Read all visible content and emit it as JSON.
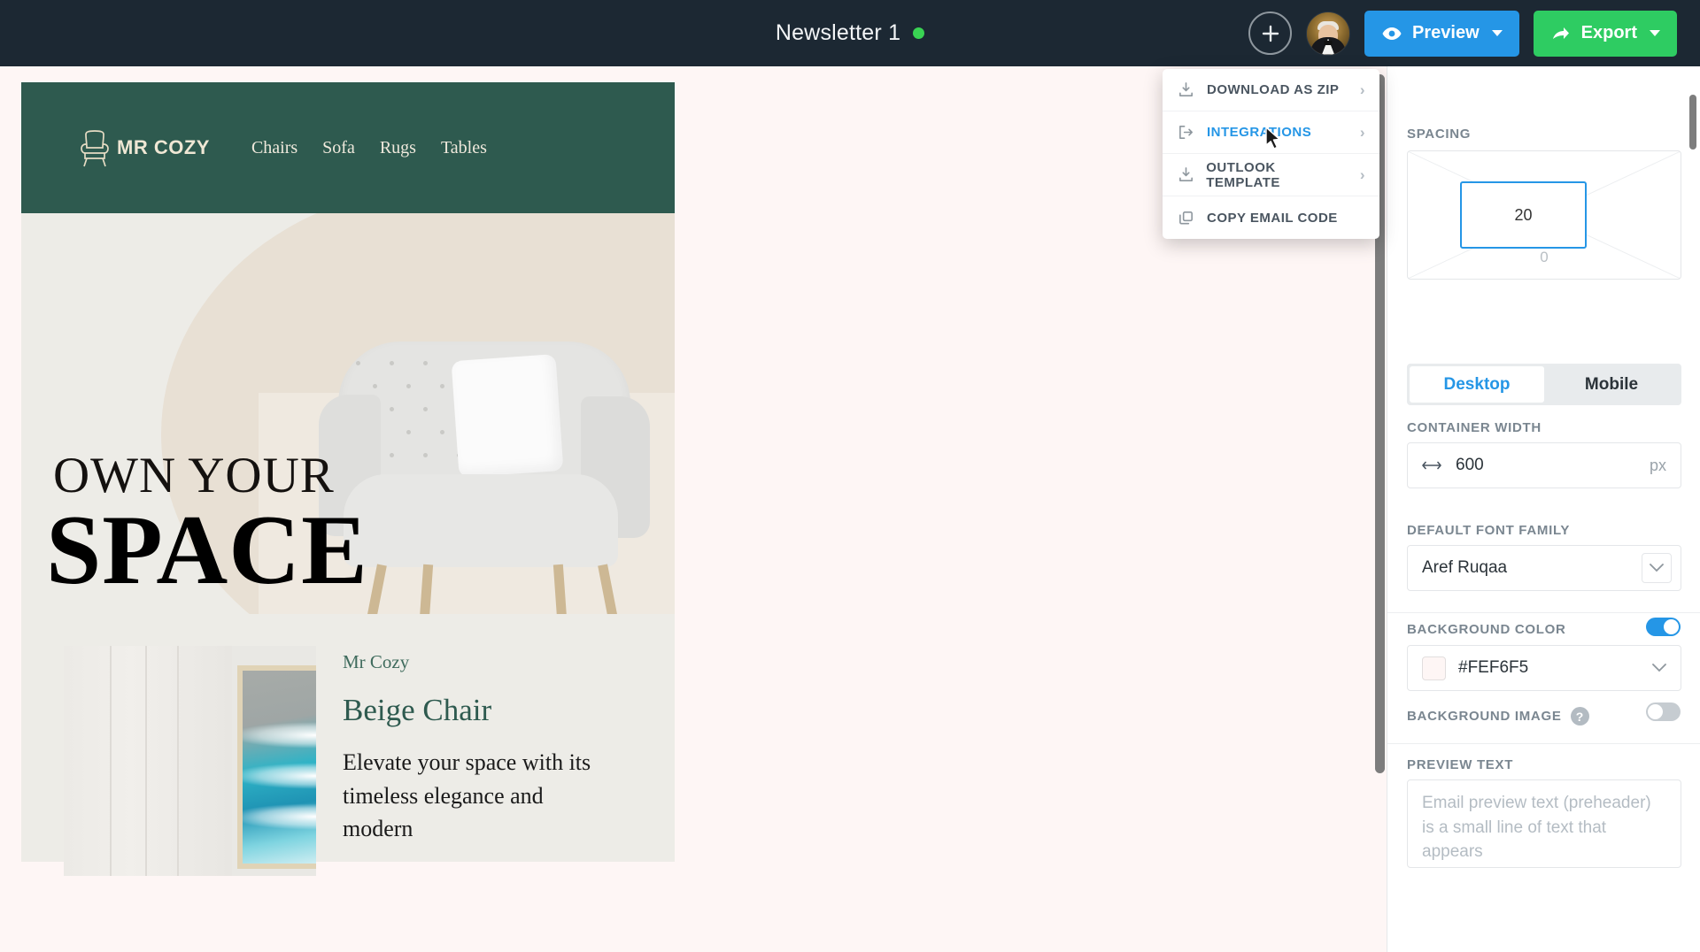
{
  "topbar": {
    "doc_title": "Newsletter 1",
    "status_dot_color": "#39d353",
    "add_button_label": "+",
    "preview_label": "Preview",
    "export_label": "Export",
    "preview_color": "#2596e6",
    "export_color": "#2ecc62",
    "bar_color": "#1c2833"
  },
  "export_menu": {
    "items": [
      {
        "label": "DOWNLOAD AS ZIP",
        "icon": "download-icon",
        "arrow": "›",
        "active": false
      },
      {
        "label": "INTEGRATIONS",
        "icon": "logout-arrow-icon",
        "arrow": "›",
        "active": true
      },
      {
        "label": "OUTLOOK TEMPLATE",
        "icon": "download-icon",
        "arrow": "›",
        "active": false
      },
      {
        "label": "COPY EMAIL CODE",
        "icon": "copy-icon",
        "arrow": "",
        "active": false
      }
    ],
    "active_color": "#2596e6"
  },
  "email": {
    "header": {
      "brand": "MR COZY",
      "logo": "chair-logo-icon",
      "nav": [
        "Chairs",
        "Sofa",
        "Rugs",
        "Tables"
      ],
      "bg_color": "#2e5a4f"
    },
    "hero": {
      "line1": "OWN YOUR",
      "line2": "SPACE",
      "bg_color": "#edece7",
      "image": "beige-tufted-armchair"
    },
    "product": {
      "brand": "Mr Cozy",
      "title": "Beige Chair",
      "description": "Elevate your space with its timeless elegance and modern",
      "image": "ocean-wave-framed-art",
      "title_color": "#2e5a4f"
    }
  },
  "panel": {
    "spacing": {
      "label": "SPACING",
      "label_visible": "SP",
      "value": "20",
      "bottom_value": "0"
    },
    "device": {
      "desktop": "Desktop",
      "mobile": "Mobile",
      "selected": "Desktop"
    },
    "container_width": {
      "label": "CONTAINER WIDTH",
      "value": "600",
      "unit": "px",
      "icon": "arrows-horizontal-icon"
    },
    "font_family": {
      "label": "DEFAULT FONT FAMILY",
      "value": "Aref Ruqaa",
      "icon": "chevron-down-icon"
    },
    "background_color": {
      "label": "BACKGROUND COLOR",
      "value": "#FEF6F5",
      "swatch": "#FEF6F5",
      "toggle_on": true
    },
    "background_image": {
      "label": "BACKGROUND IMAGE",
      "help": "?",
      "toggle_on": false
    },
    "preview_text": {
      "label": "PREVIEW TEXT",
      "placeholder": "Email preview text (preheader) is a small line of text that appears"
    }
  }
}
